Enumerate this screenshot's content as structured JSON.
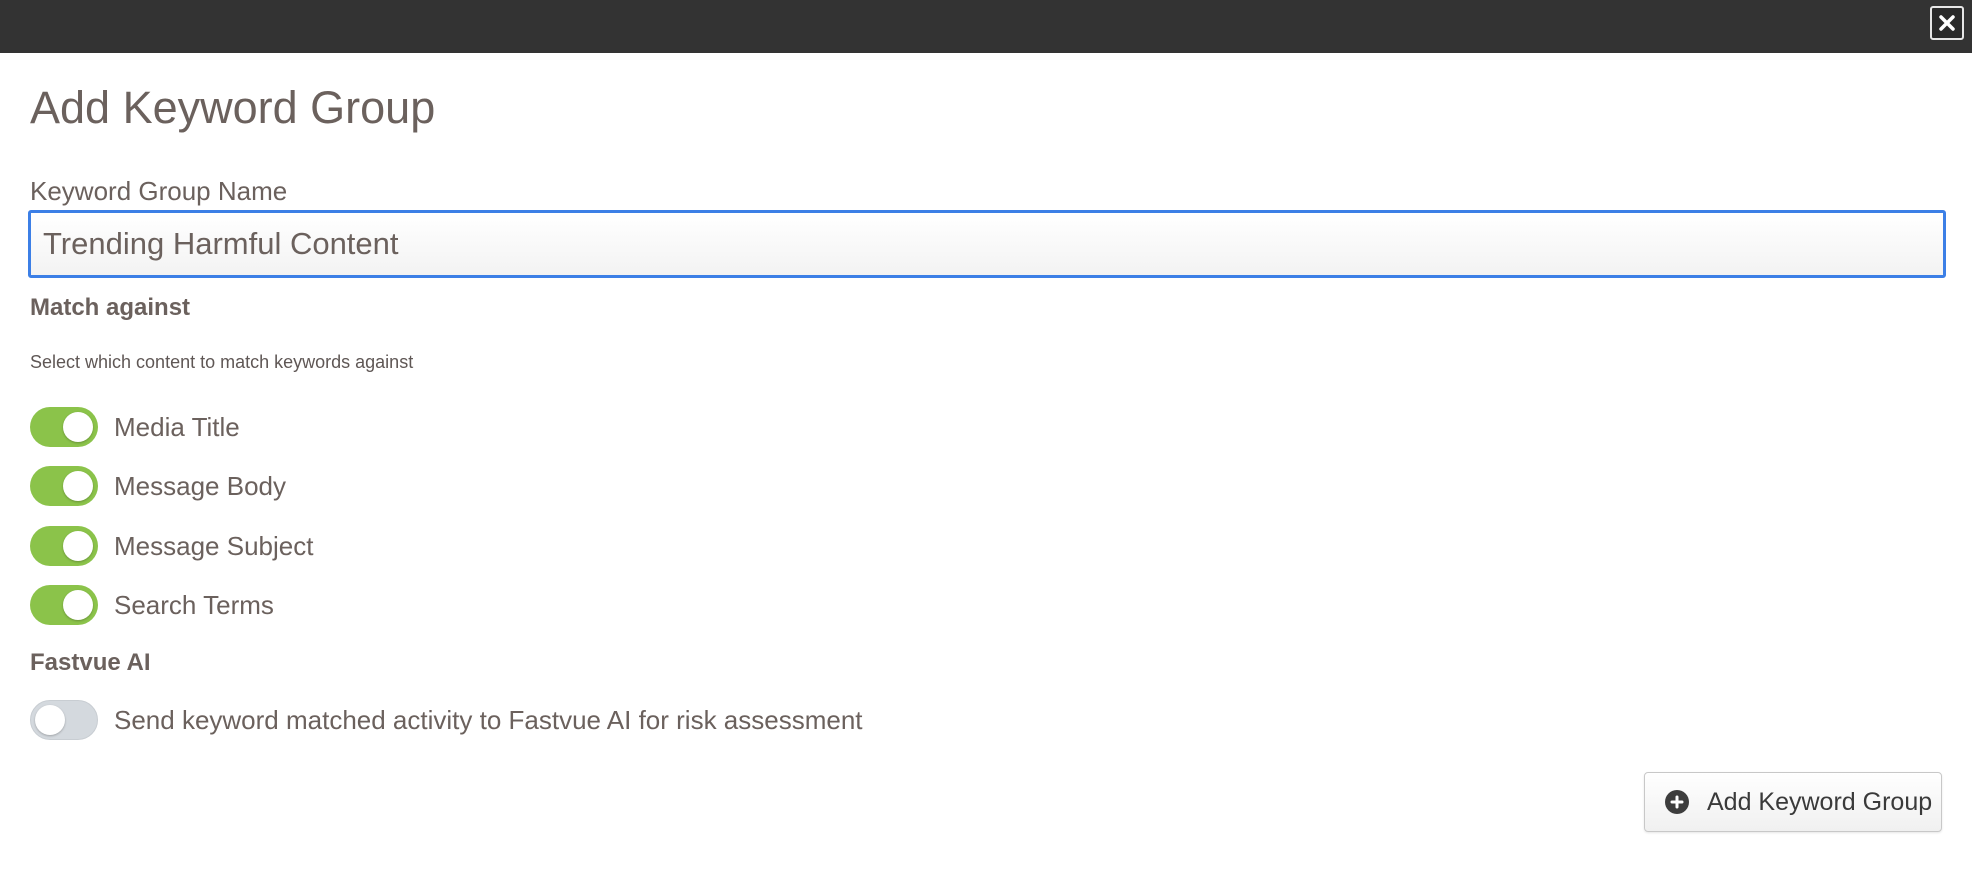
{
  "dialog": {
    "title": "Add Keyword Group",
    "name_label": "Keyword Group Name",
    "name_value": "Trending Harmful Content",
    "match_section": {
      "heading": "Match against",
      "helper": "Select which content to match keywords against",
      "toggles": [
        {
          "label": "Media Title",
          "on": true
        },
        {
          "label": "Message Body",
          "on": true
        },
        {
          "label": "Message Subject",
          "on": true
        },
        {
          "label": "Search Terms",
          "on": true
        }
      ]
    },
    "ai_section": {
      "heading": "Fastvue AI",
      "toggle": {
        "label": "Send keyword matched activity to Fastvue AI for risk assessment",
        "on": false
      }
    },
    "submit_label": "Add Keyword Group",
    "colors": {
      "toggle_on": "#8bc34a",
      "toggle_off": "#d4d9de",
      "input_focus": "#3c7fe6",
      "topbar": "#333333"
    }
  }
}
